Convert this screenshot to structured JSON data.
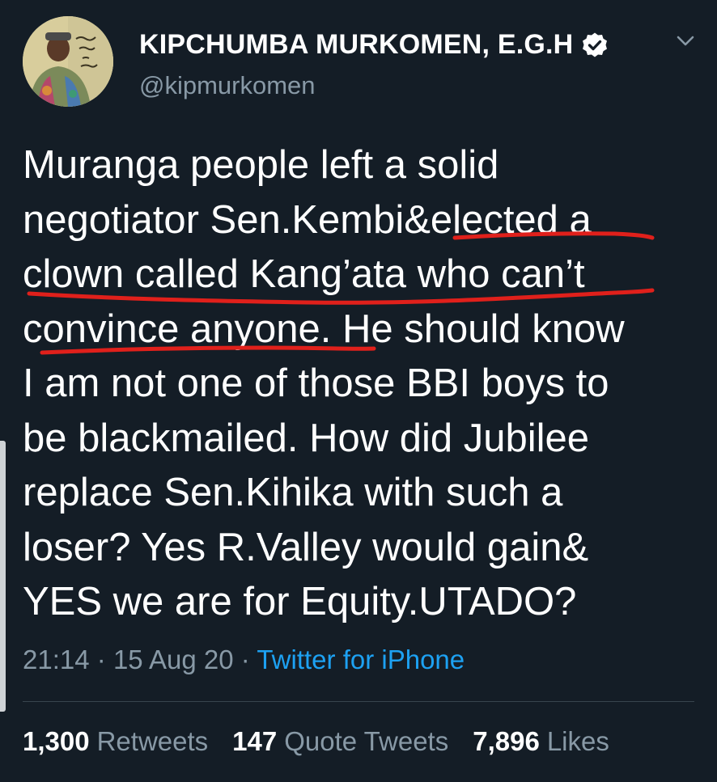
{
  "author": {
    "display_name": "KIPCHUMBA MURKOMEN, E.G.H",
    "handle": "@kipmurkomen",
    "verified": true
  },
  "tweet": {
    "text": "Muranga people left a solid\nnegotiator Sen.Kembi&elected a\nclown called Kang’ata who can’t\nconvince anyone. He should know\nI am not one of those BBI boys to\nbe blackmailed. How did Jubilee\nreplace Sen.Kihika with such a\nloser? Yes R.Valley would gain&\nYES we are for Equity.UTADO?"
  },
  "meta": {
    "time": "21:14",
    "separator": "·",
    "date": "15 Aug 20",
    "source": "Twitter for iPhone"
  },
  "stats": {
    "retweets_count": "1,300",
    "retweets_label": "Retweets",
    "quote_count": "147",
    "quote_label": "Quote Tweets",
    "likes_count": "7,896",
    "likes_label": "Likes"
  },
  "icons": {
    "verified": "verified-badge-icon",
    "more": "chevron-down-icon"
  },
  "colors": {
    "background": "#141d26",
    "secondary_text": "#8899a6",
    "link": "#1da1f2",
    "annotation": "#e0201b"
  }
}
